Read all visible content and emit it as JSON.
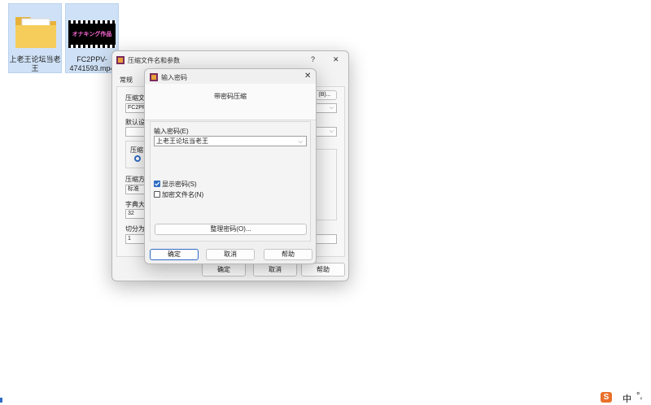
{
  "desktop": {
    "folder": {
      "label": "上老王论坛当老王"
    },
    "video": {
      "label": "FC2PPV-4741593.mp4",
      "thumb_text": "オナキング作品"
    }
  },
  "back_window": {
    "title": "压缩文件名和参数",
    "help_glyph": "?",
    "close_glyph": "✕",
    "tab_general": "常规",
    "label_archive": "压缩文",
    "archive_value": "FC2PP",
    "browse_label": "(B)...",
    "label_default": "默认设",
    "label_compress": "压缩",
    "label_method": "压缩方",
    "method_value": "标准",
    "label_dict": "字典大",
    "dict_value": "32",
    "label_split": "切分为",
    "split_value": "1",
    "ok": "确定",
    "cancel": "取消",
    "help": "帮助"
  },
  "dialog": {
    "title": "输入密码",
    "close_glyph": "✕",
    "subtitle": "带密码压缩",
    "password_label": "输入密码(E)",
    "password_value": "上老王论坛当老王",
    "show_password_label": "显示密码(S)",
    "show_password_checked": true,
    "encrypt_names_label": "加密文件名(N)",
    "encrypt_names_checked": false,
    "organize_button": "整理密码(O)...",
    "ok": "确定",
    "cancel": "取消",
    "help": "帮助"
  },
  "taskbar": {
    "ime_logo": "S",
    "ime_mode": "中",
    "ime_punct": "°,"
  },
  "colors": {
    "accent": "#2f6bc4",
    "folder": "#f2c94c",
    "selection": "#cfe1f6"
  }
}
